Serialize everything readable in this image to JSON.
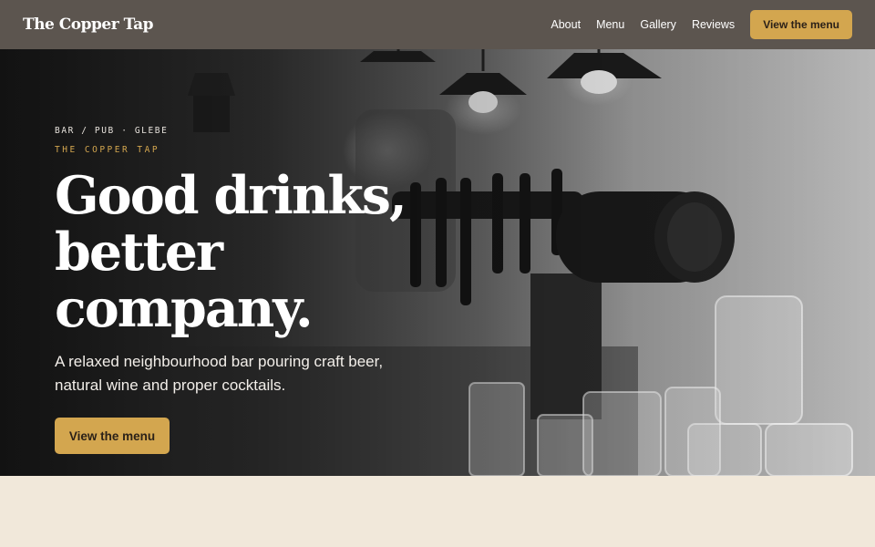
{
  "nav": {
    "logo": "The Copper Tap",
    "links": [
      "About",
      "Menu",
      "Gallery",
      "Reviews"
    ],
    "cta": "View the menu"
  },
  "hero": {
    "eyebrow": "BAR / PUB · GLEBE",
    "brand": "THE COPPER TAP",
    "headline_line1": "Good drinks,",
    "headline_line2": "better company.",
    "subhead": "A relaxed neighbourhood bar pouring craft beer, natural wine and proper cocktails.",
    "cta": "View the menu"
  },
  "colors": {
    "accent": "#d3a64f",
    "nav_bg": "#5c554f",
    "page_bg": "#f1e8da"
  }
}
